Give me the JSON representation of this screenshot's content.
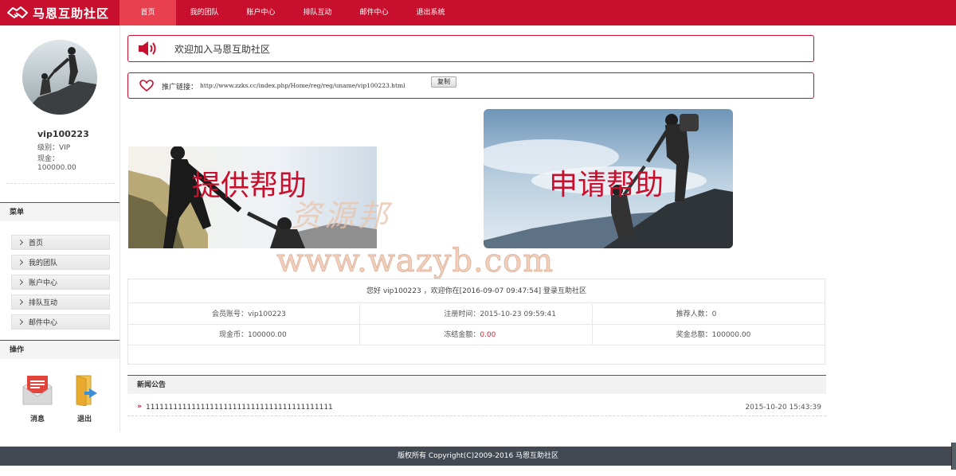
{
  "brand": {
    "name": "马恩互助社区",
    "accent": "#c8102e"
  },
  "nav": {
    "items": [
      {
        "label": "首页",
        "active": true
      },
      {
        "label": "我的团队",
        "active": false
      },
      {
        "label": "账户中心",
        "active": false
      },
      {
        "label": "排队互动",
        "active": false
      },
      {
        "label": "邮件中心",
        "active": false
      },
      {
        "label": "退出系统",
        "active": false
      }
    ]
  },
  "user": {
    "name": "vip100223",
    "level_text": "级别：VIP",
    "cash_label": "现金：",
    "cash_value": "100000.00"
  },
  "sidebar": {
    "menu_title": "菜单",
    "menu_items": [
      "首页",
      "我的团队",
      "账户中心",
      "排队互动",
      "邮件中心"
    ],
    "ops_title": "操作",
    "ops": [
      {
        "label": "消息",
        "icon": "mail-icon"
      },
      {
        "label": "退出",
        "icon": "folder-exit-icon"
      }
    ]
  },
  "notice": {
    "text": "欢迎加入马恩互助社区",
    "icon": "speaker-icon"
  },
  "referral": {
    "label": "推广链接：",
    "url": "http://www.zzks.cc/index.php/Home/reg/reg/uname/vip100223.html",
    "copy_label": "复制",
    "icon": "heart-icon"
  },
  "banners": {
    "provide": "提供帮助",
    "apply": "申请帮助"
  },
  "watermark": {
    "cn": "资源邦",
    "en": "www.wazyb.com"
  },
  "info": {
    "welcome": "您好 vip100223 ，欢迎你在[2016-09-07 09:47:54] 登录互助社区",
    "rows": [
      [
        {
          "label": "会员账号：",
          "value": "vip100223"
        },
        {
          "label": "注册时间：",
          "value": "2015-10-23 09:59:41"
        },
        {
          "label": "推荐人数：",
          "value": "0"
        }
      ],
      [
        {
          "label": "现金币：",
          "value": "100000.00"
        },
        {
          "label": "冻结金额：",
          "value": "0.00"
        },
        {
          "label": "奖金总额：",
          "value": "100000.00"
        }
      ]
    ]
  },
  "news": {
    "title": "新闻公告",
    "items": [
      {
        "title": "11111111111111111111111111111111111111111",
        "date": "2015-10-20 15:43:39"
      }
    ]
  },
  "footer": {
    "text": "版权所有 Copyright(C)2009-2016 马恩互助社区"
  }
}
